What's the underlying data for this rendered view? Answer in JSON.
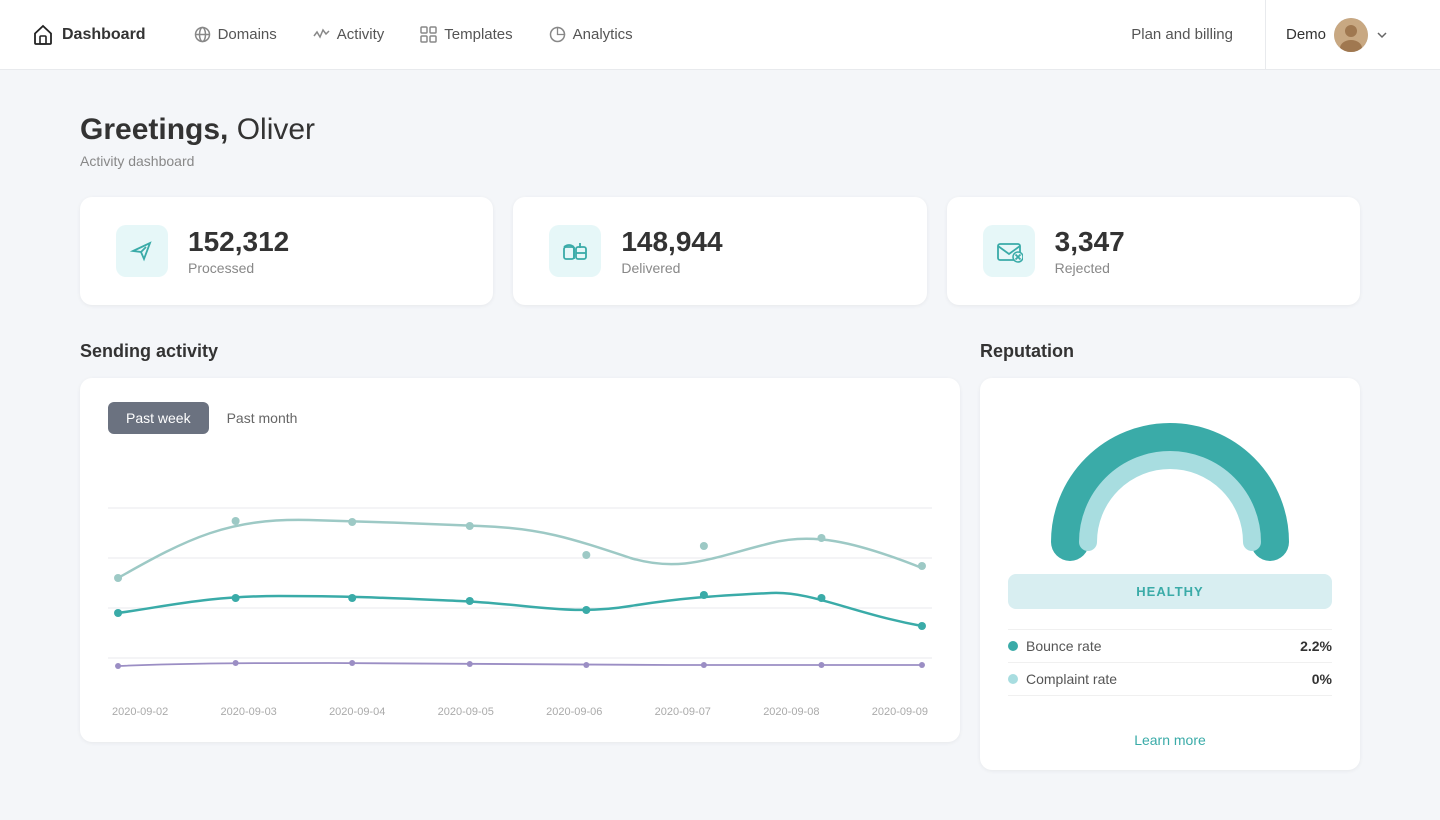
{
  "nav": {
    "brand": "Dashboard",
    "links": [
      {
        "id": "domains",
        "label": "Domains",
        "icon": "globe"
      },
      {
        "id": "activity",
        "label": "Activity",
        "icon": "activity"
      },
      {
        "id": "templates",
        "label": "Templates",
        "icon": "grid"
      },
      {
        "id": "analytics",
        "label": "Analytics",
        "icon": "pie"
      }
    ],
    "plan_billing": "Plan and billing",
    "user": "Demo"
  },
  "greeting": {
    "prefix": "Greetings,",
    "name": " Oliver",
    "subtitle": "Activity dashboard"
  },
  "stats": [
    {
      "id": "processed",
      "value": "152,312",
      "label": "Processed",
      "icon": "send"
    },
    {
      "id": "delivered",
      "value": "148,944",
      "label": "Delivered",
      "icon": "mailbox"
    },
    {
      "id": "rejected",
      "value": "3,347",
      "label": "Rejected",
      "icon": "mail-x"
    }
  ],
  "activity": {
    "title": "Sending activity",
    "tabs": [
      {
        "id": "week",
        "label": "Past week",
        "active": true
      },
      {
        "id": "month",
        "label": "Past month",
        "active": false
      }
    ],
    "x_labels": [
      "2020-09-02",
      "2020-09-03",
      "2020-09-04",
      "2020-09-05",
      "2020-09-06",
      "2020-09-07",
      "2020-09-08",
      "2020-09-09"
    ]
  },
  "reputation": {
    "title": "Reputation",
    "status": "HEALTHY",
    "metrics": [
      {
        "id": "bounce",
        "label": "Bounce rate",
        "value": "2.2%",
        "color": "#3aaba8"
      },
      {
        "id": "complaint",
        "label": "Complaint rate",
        "value": "0%",
        "color": "#a8dde0"
      }
    ],
    "learn_more": "Learn more"
  },
  "colors": {
    "teal": "#3aaba8",
    "light_teal": "#a8dde0",
    "purple": "#9b8ec4",
    "accent": "#3aaba8"
  }
}
